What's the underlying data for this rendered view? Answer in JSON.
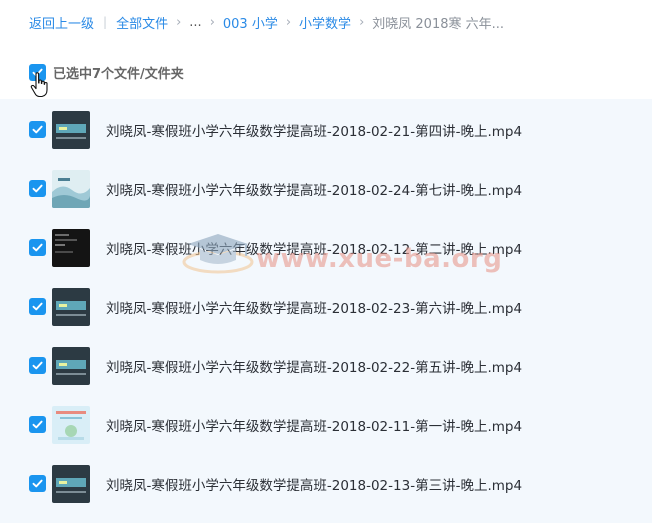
{
  "breadcrumb": {
    "back": "返回上一级",
    "sep": "|",
    "all_files": "全部文件",
    "ellipsis": "...",
    "level1": "003 小学",
    "level2": "小学数学",
    "current": "刘晓凤 2018寒 六年..."
  },
  "selection": {
    "label": "已选中7个文件/文件夹",
    "checked": true
  },
  "watermark": {
    "text": "www.xue-ba.org"
  },
  "files": [
    {
      "name": "刘晓凤-寒假班小学六年级数学提高班-2018-02-21-第四讲-晚上.mp4",
      "checked": true,
      "thumb": "dark"
    },
    {
      "name": "刘晓凤-寒假班小学六年级数学提高班-2018-02-24-第七讲-晚上.mp4",
      "checked": true,
      "thumb": "light"
    },
    {
      "name": "刘晓凤-寒假班小学六年级数学提高班-2018-02-12-第二讲-晚上.mp4",
      "checked": true,
      "thumb": "black"
    },
    {
      "name": "刘晓凤-寒假班小学六年级数学提高班-2018-02-23-第六讲-晚上.mp4",
      "checked": true,
      "thumb": "dark"
    },
    {
      "name": "刘晓凤-寒假班小学六年级数学提高班-2018-02-22-第五讲-晚上.mp4",
      "checked": true,
      "thumb": "dark"
    },
    {
      "name": "刘晓凤-寒假班小学六年级数学提高班-2018-02-11-第一讲-晚上.mp4",
      "checked": true,
      "thumb": "pale"
    },
    {
      "name": "刘晓凤-寒假班小学六年级数学提高班-2018-02-13-第三讲-晚上.mp4",
      "checked": true,
      "thumb": "dark"
    }
  ],
  "colors": {
    "accent": "#1a95ef",
    "link": "#2a8ae6",
    "list_background": "#f3f8fd"
  },
  "icons": {
    "checkbox": "checkmark-icon",
    "cursor": "hand-pointer-icon",
    "thumbnail": "video-thumbnail"
  }
}
